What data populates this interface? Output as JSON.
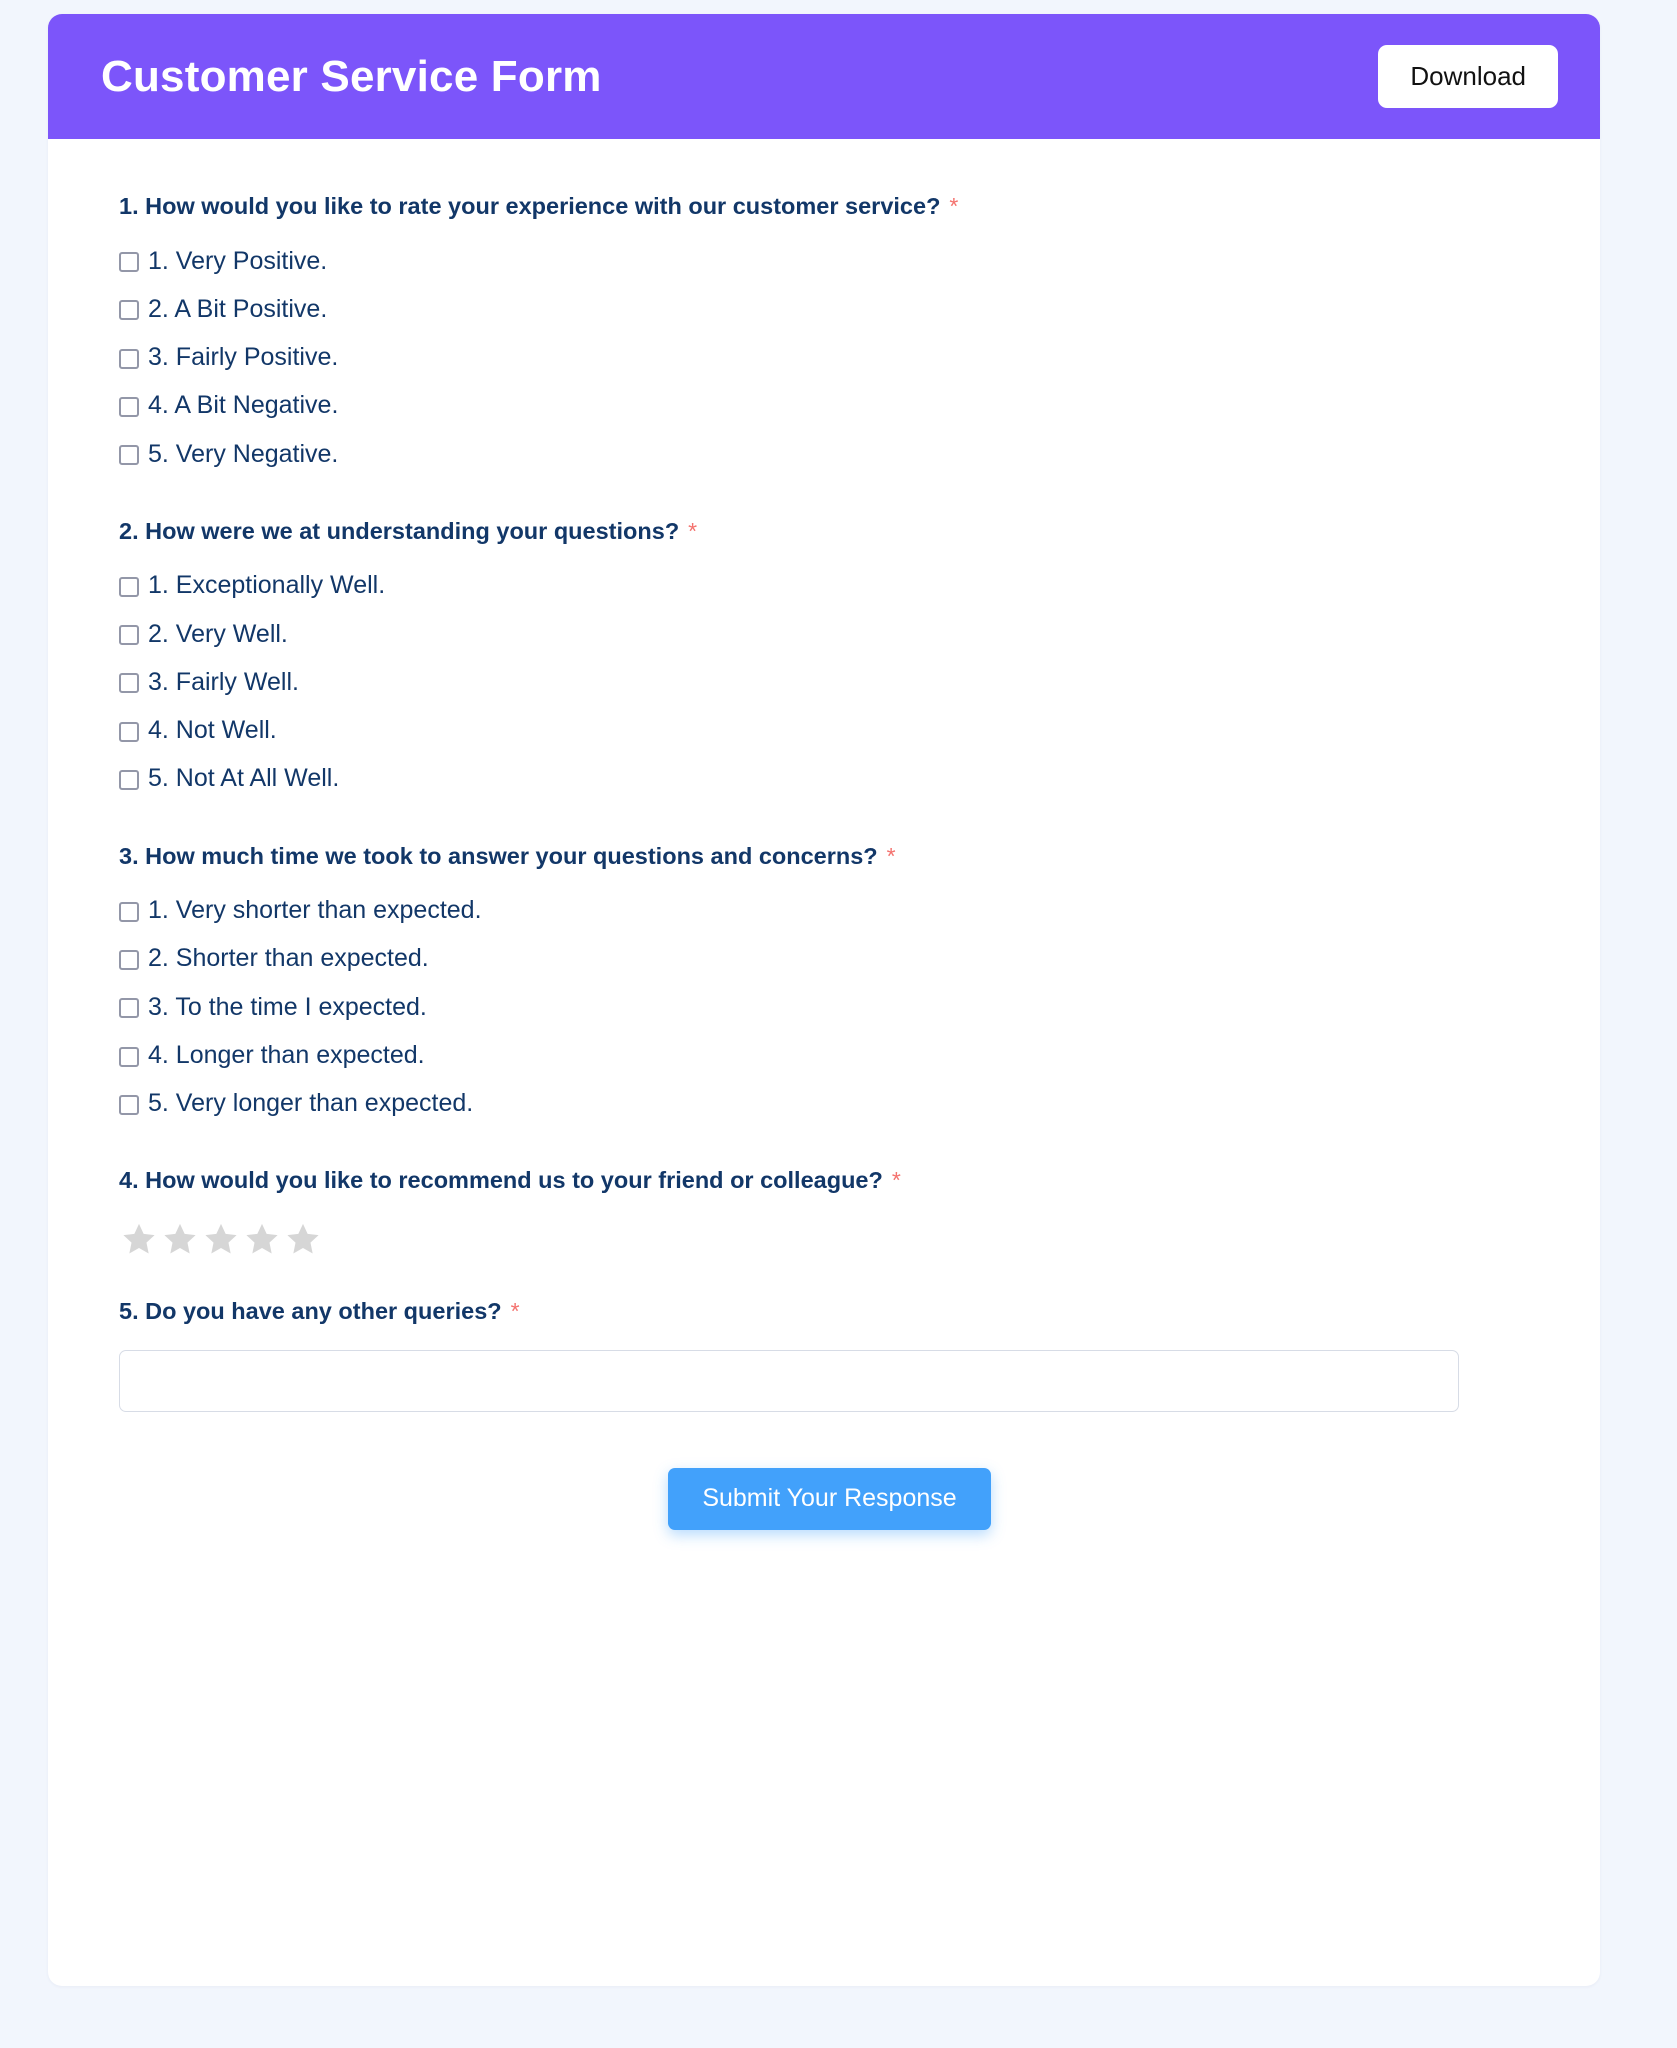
{
  "header": {
    "title": "Customer Service Form",
    "download_label": "Download",
    "background_color": "#7c55fa",
    "title_color": "#ffffff"
  },
  "theme": {
    "page_background": "#f2f6fd",
    "card_background": "#ffffff",
    "question_text_color": "#123768",
    "required_star_color": "#f4726e",
    "checkbox_border_color": "#9397a8",
    "submit_button_color": "#42a1fb",
    "star_empty_color": "#d6d6d6"
  },
  "questions": [
    {
      "title": "1. How would you like to rate your experience with our customer service?",
      "required_marker": "*",
      "type": "checkbox",
      "options": [
        "1. Very Positive.",
        "2. A Bit Positive.",
        "3. Fairly Positive.",
        "4. A Bit Negative.",
        "5. Very Negative."
      ]
    },
    {
      "title": "2. How were we at understanding your questions?",
      "required_marker": "*",
      "type": "checkbox",
      "options": [
        "1. Exceptionally Well.",
        "2. Very Well.",
        "3. Fairly Well.",
        "4. Not Well.",
        "5. Not At All Well."
      ]
    },
    {
      "title": "3. How much time we took to answer your questions and concerns?",
      "required_marker": "*",
      "type": "checkbox",
      "options": [
        "1. Very shorter than expected.",
        "2. Shorter than expected.",
        "3. To the time I expected.",
        "4. Longer than expected.",
        "5. Very longer than expected."
      ]
    },
    {
      "title": "4. How would you like to recommend us to your friend or colleague?",
      "required_marker": "*",
      "type": "star-rating",
      "star_count": 5,
      "stars_filled": 0
    },
    {
      "title": "5. Do you have any other queries?",
      "required_marker": "*",
      "type": "text",
      "value": "",
      "placeholder": ""
    }
  ],
  "footer": {
    "submit_label": "Submit Your Response"
  }
}
